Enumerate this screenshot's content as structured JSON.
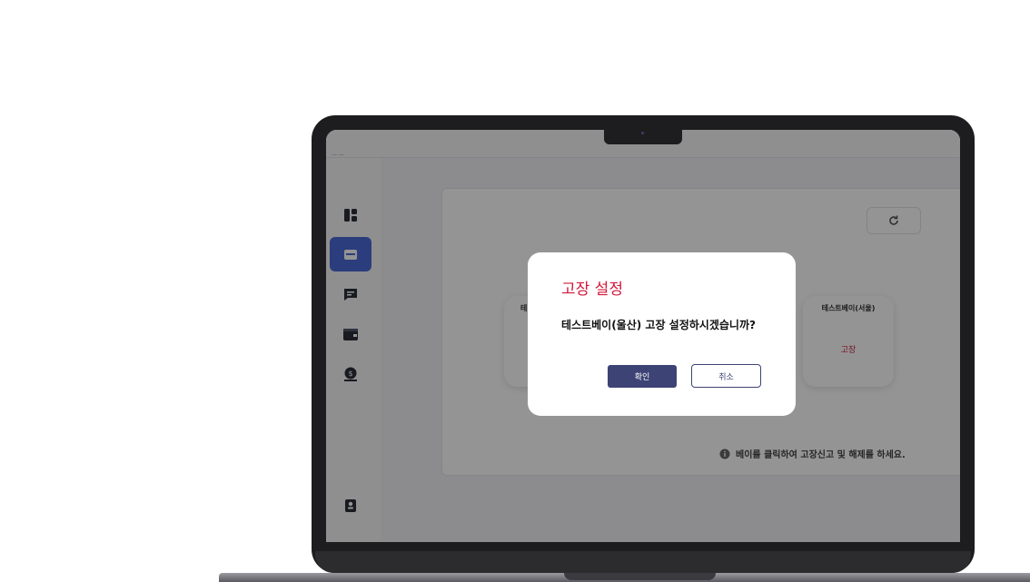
{
  "app": {
    "topbar_logo": "— —"
  },
  "sidebar": {
    "items": [
      {
        "icon": "dashboard-icon",
        "active": false
      },
      {
        "icon": "bay-icon",
        "active": true
      },
      {
        "icon": "message-icon",
        "active": false
      },
      {
        "icon": "wallet-icon",
        "active": false
      },
      {
        "icon": "money-bag-icon",
        "active": false
      },
      {
        "icon": "user-profile-icon",
        "active": false
      }
    ]
  },
  "main": {
    "bays": [
      {
        "name": "테",
        "status": ""
      },
      {
        "name": "테스트베이(서울)",
        "status": "고장"
      }
    ],
    "hint": "베이를 클릭하여 고장신고 및 해제를 하세요."
  },
  "modal": {
    "title": "고장 설정",
    "message": "테스트베이(울산) 고장 설정하시겠습니까?",
    "confirm_label": "확인",
    "cancel_label": "취소"
  },
  "colors": {
    "accent": "#4a6ad6",
    "danger": "#d5173a",
    "primary_button": "#3d4374"
  }
}
